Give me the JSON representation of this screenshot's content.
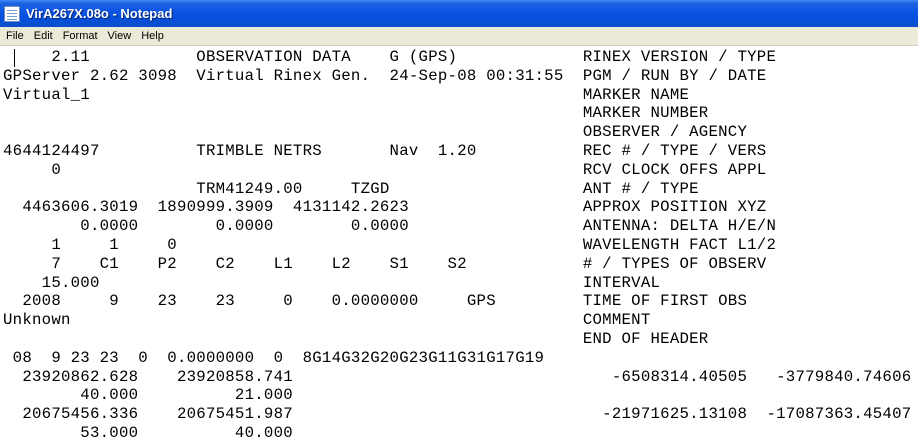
{
  "window": {
    "title": "VirA267X.08o - Notepad",
    "icon": "notepad-icon"
  },
  "menu": {
    "items": [
      "File",
      "Edit",
      "Format",
      "View",
      "Help"
    ]
  },
  "editor": {
    "lines": [
      "     2.11           OBSERVATION DATA    G (GPS)             RINEX VERSION / TYPE",
      "GPServer 2.62 3098  Virtual Rinex Gen.  24-Sep-08 00:31:55  PGM / RUN BY / DATE",
      "Virtual_1                                                   MARKER NAME",
      "                                                            MARKER NUMBER",
      "                                                            OBSERVER / AGENCY",
      "4644124497          TRIMBLE NETRS       Nav  1.20           REC # / TYPE / VERS",
      "     0                                                      RCV CLOCK OFFS APPL",
      "                    TRM41249.00     TZGD                    ANT # / TYPE",
      "  4463606.3019  1890999.3909  4131142.2623                  APPROX POSITION XYZ",
      "        0.0000        0.0000        0.0000                  ANTENNA: DELTA H/E/N",
      "     1     1     0                                          WAVELENGTH FACT L1/2",
      "     7    C1    P2    C2    L1    L2    S1    S2            # / TYPES OF OBSERV",
      "    15.000                                                  INTERVAL",
      "  2008     9    23    23     0    0.0000000     GPS         TIME OF FIRST OBS",
      "Unknown                                                     COMMENT",
      "                                                            END OF HEADER",
      " 08  9 23 23  0  0.0000000  0  8G14G32G20G23G11G31G17G19",
      "  23920862.628    23920858.741                                 -6508314.40505   -3779840.74606",
      "        40.000          21.000",
      "  20675456.336    20675451.987                                -21971625.13108  -17087363.45407",
      "        53.000          40.000"
    ]
  }
}
